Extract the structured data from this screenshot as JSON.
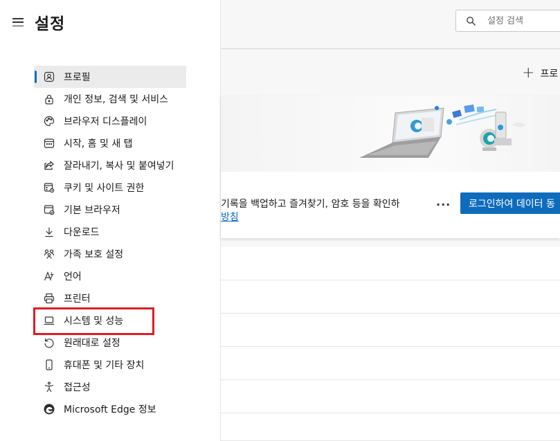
{
  "nav": {
    "title": "설정",
    "items": [
      {
        "label": "프로필",
        "icon": "profile-icon",
        "active": true
      },
      {
        "label": "개인 정보, 검색 및 서비스",
        "icon": "lock-icon"
      },
      {
        "label": "브라우저 디스플레이",
        "icon": "palette-icon"
      },
      {
        "label": "시작, 홈 및 새 탭",
        "icon": "start-page-icon"
      },
      {
        "label": "잘라내기, 복사 및 붙여넣기",
        "icon": "share-icon"
      },
      {
        "label": "쿠키 및 사이트 권한",
        "icon": "site-permissions-icon"
      },
      {
        "label": "기본 브라우저",
        "icon": "default-browser-icon"
      },
      {
        "label": "다운로드",
        "icon": "download-icon"
      },
      {
        "label": "가족 보호 설정",
        "icon": "family-icon"
      },
      {
        "label": "언어",
        "icon": "language-icon"
      },
      {
        "label": "프린터",
        "icon": "printer-icon"
      },
      {
        "label": "시스템 및 성능",
        "icon": "laptop-icon",
        "highlighted": true
      },
      {
        "label": "원래대로 설정",
        "icon": "reset-icon"
      },
      {
        "label": "휴대폰 및 기타 장치",
        "icon": "phone-icon"
      },
      {
        "label": "접근성",
        "icon": "accessibility-icon"
      },
      {
        "label": "Microsoft Edge 정보",
        "icon": "edge-logo-icon"
      }
    ]
  },
  "search": {
    "placeholder": "설정 검색"
  },
  "profile": {
    "add_label": "프로",
    "card_text": "기록을 백업하고 즐겨찾기, 암호 등을 확인하",
    "card_link": "방침",
    "signin_label": "로그인하여 데이터 동"
  },
  "colors": {
    "accent": "#0f6cbd",
    "highlight": "#e01b24",
    "active_bg": "#ebebeb"
  }
}
